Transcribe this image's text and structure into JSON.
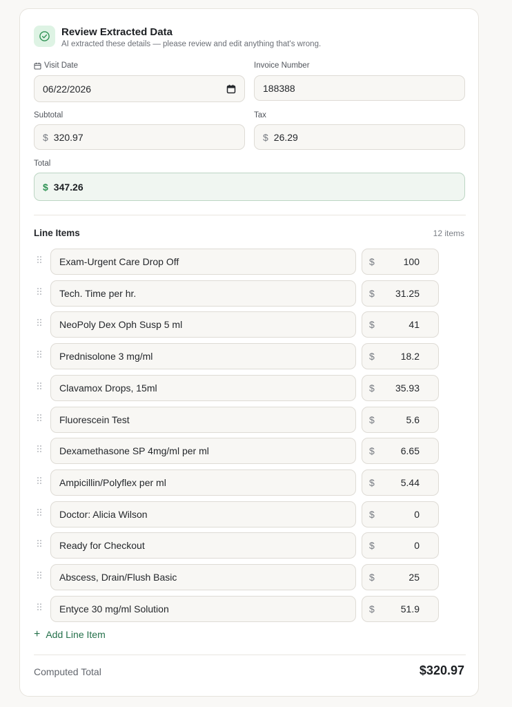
{
  "header": {
    "title": "Review Extracted Data",
    "subtitle": "AI extracted these details — please review and edit anything that's wrong.",
    "icon": "check-circle-icon",
    "accent": "#2f9254"
  },
  "fields": {
    "visit_date": {
      "label": "Visit Date",
      "value": "06/22/2026",
      "icon": "calendar-icon"
    },
    "invoice_number": {
      "label": "Invoice Number",
      "value": "188388"
    },
    "subtotal": {
      "label": "Subtotal",
      "currency": "$",
      "value": "320.97"
    },
    "tax": {
      "label": "Tax",
      "currency": "$",
      "value": "26.29"
    },
    "total": {
      "label": "Total",
      "currency": "$",
      "value": "347.26"
    }
  },
  "line_items": {
    "title": "Line Items",
    "count_label": "12 items",
    "currency": "$",
    "items": [
      {
        "description": "Exam-Urgent Care Drop Off",
        "amount": "100"
      },
      {
        "description": "Tech. Time per hr.",
        "amount": "31.25"
      },
      {
        "description": "NeoPoly Dex Oph Susp 5 ml",
        "amount": "41"
      },
      {
        "description": "Prednisolone 3 mg/ml",
        "amount": "18.2"
      },
      {
        "description": "Clavamox Drops, 15ml",
        "amount": "35.93"
      },
      {
        "description": "Fluorescein Test",
        "amount": "5.6"
      },
      {
        "description": "Dexamethasone SP 4mg/ml per ml",
        "amount": "6.65"
      },
      {
        "description": "Ampicillin/Polyflex per ml",
        "amount": "5.44"
      },
      {
        "description": "Doctor: Alicia Wilson",
        "amount": "0"
      },
      {
        "description": "Ready for Checkout",
        "amount": "0"
      },
      {
        "description": "Abscess, Drain/Flush Basic",
        "amount": "25"
      },
      {
        "description": "Entyce 30 mg/ml Solution",
        "amount": "51.9"
      }
    ],
    "add_label": "Add Line Item"
  },
  "footer": {
    "computed_label": "Computed Total",
    "computed_value": "$320.97"
  }
}
